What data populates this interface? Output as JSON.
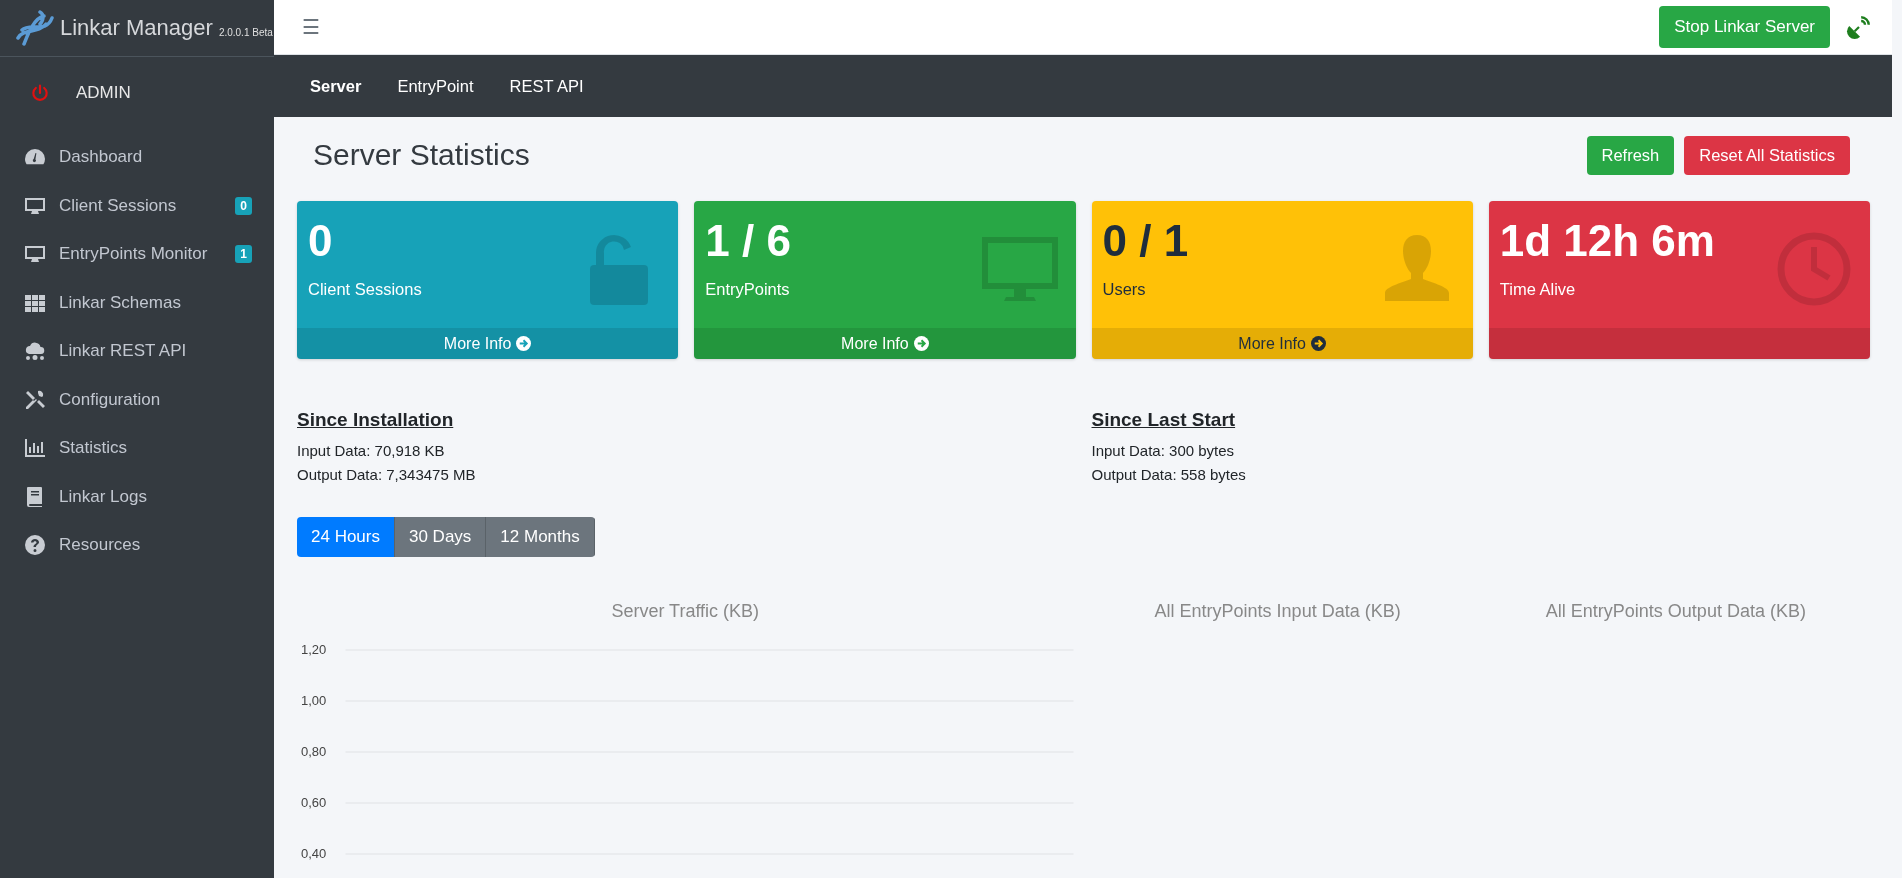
{
  "brand": {
    "name": "Linkar Manager",
    "version": "2.0.0.1 Beta"
  },
  "user": {
    "name": "ADMIN"
  },
  "sidebar": {
    "items": [
      {
        "label": "Dashboard"
      },
      {
        "label": "Client Sessions",
        "badge": "0"
      },
      {
        "label": "EntryPoints Monitor",
        "badge": "1"
      },
      {
        "label": "Linkar Schemas"
      },
      {
        "label": "Linkar REST API"
      },
      {
        "label": "Configuration"
      },
      {
        "label": "Statistics"
      },
      {
        "label": "Linkar Logs"
      },
      {
        "label": "Resources"
      }
    ]
  },
  "topbar": {
    "menu_icon": "☰",
    "stop_button": "Stop Linkar Server"
  },
  "tabs": [
    {
      "label": "Server",
      "selected": true
    },
    {
      "label": "EntryPoint",
      "selected": false
    },
    {
      "label": "REST API",
      "selected": false
    }
  ],
  "page_title": "Server Statistics",
  "actions": [
    {
      "label": "Refresh",
      "kind": "success"
    },
    {
      "label": "Reset All Statistics",
      "kind": "danger"
    }
  ],
  "cards": [
    {
      "value": "0",
      "label": "Client Sessions",
      "color": "#17a2b8",
      "footer": "More Info"
    },
    {
      "value": "1 / 6",
      "label": "EntryPoints",
      "color": "#28a745",
      "footer": "More Info"
    },
    {
      "value": "0 / 1",
      "label": "Users",
      "color": "#ffc107",
      "footer": "More Info"
    },
    {
      "value": "1d 12h 6m",
      "label": "Time Alive",
      "color": "#dc3545"
    }
  ],
  "since_installation": {
    "heading": "Since Installation",
    "lines": [
      "Input Data: 70,918 KB",
      "Output Data: 7,343475 MB"
    ]
  },
  "since_last_start": {
    "heading": "Since Last Start",
    "lines": [
      "Input Data: 300 bytes",
      "Output Data: 558 bytes"
    ]
  },
  "ranges": [
    {
      "label": "24 Hours",
      "selected": true
    },
    {
      "label": "30 Days",
      "selected": false
    },
    {
      "label": "12 Months",
      "selected": false
    }
  ],
  "traffic_chart": {
    "title": "Server Traffic (KB)",
    "axis_labels": [
      "1,20",
      "1,00",
      "0,80",
      "0,60",
      "0,40"
    ]
  },
  "input_chart": {
    "title": "All EntryPoints Input Data (KB)"
  },
  "output_chart": {
    "title": "All EntryPoints Output Data (KB)"
  }
}
